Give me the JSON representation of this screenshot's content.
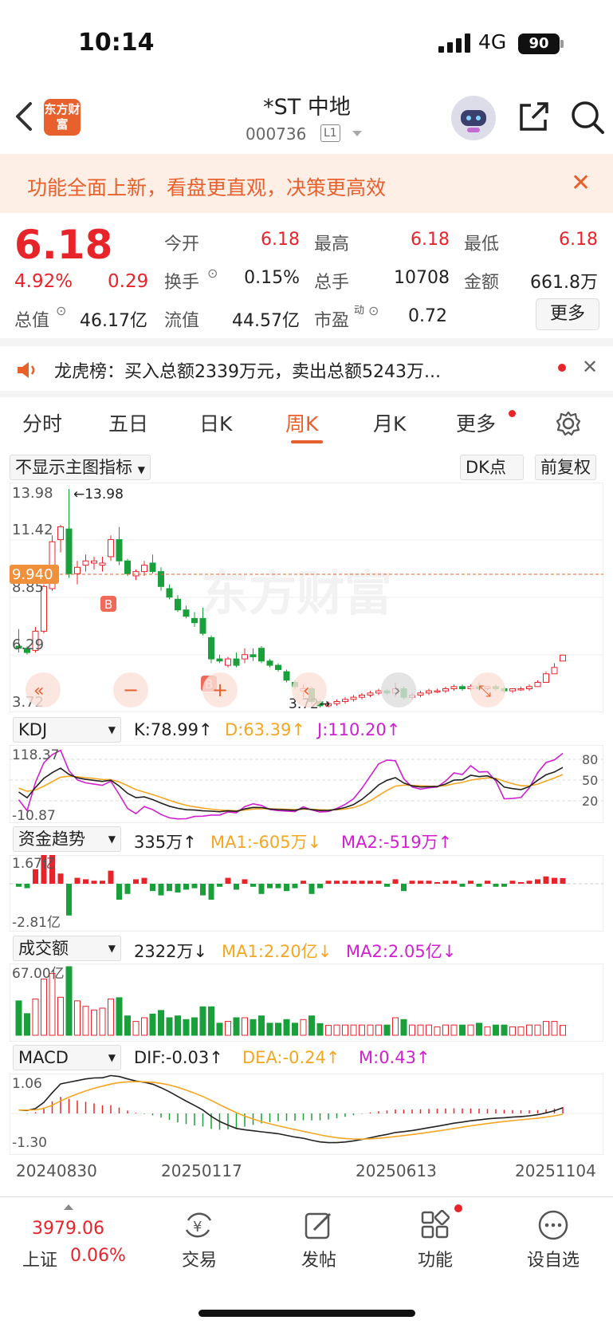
{
  "status_bar": {
    "time": "10:14",
    "network": "4G",
    "battery": "90"
  },
  "header": {
    "title": "*ST 中地",
    "code": "000736",
    "level": "L1",
    "logo_text": "东方财富"
  },
  "banner": {
    "text": "功能全面上新，看盘更直观，决策更高效"
  },
  "quote": {
    "price": "6.18",
    "change_pct": "4.92%",
    "change": "0.29",
    "open_label": "今开",
    "open": "6.18",
    "high_label": "最高",
    "high": "6.18",
    "low_label": "最低",
    "low": "6.18",
    "turnover_label": "换手",
    "turnover": "0.15%",
    "volume_label": "总手",
    "volume": "10708",
    "amount_label": "金额",
    "amount": "661.8万",
    "mktcap_label": "总值",
    "mktcap": "46.17亿",
    "float_label": "流值",
    "float": "44.57亿",
    "pe_label": "市盈",
    "pe_sup": "动",
    "pe": "0.72",
    "more_label": "更多"
  },
  "dragon_tiger": {
    "text": "龙虎榜：买入总额2339万元，卖出总额5243万..."
  },
  "tabs": [
    "分时",
    "五日",
    "日K",
    "周K",
    "月K",
    "更多"
  ],
  "active_tab": "周K",
  "chart_controls": {
    "indicator_select": "不显示主图指标",
    "dk_label": "DK点",
    "adjust_label": "前复权"
  },
  "colors": {
    "up": "#e8242b",
    "down": "#1aa03b",
    "accent": "#e8602c",
    "dif": "#222222",
    "dea": "#f5a623",
    "macd_m": "#d020d0"
  },
  "main_chart": {
    "y_labels": [
      "13.98",
      "11.42",
      "8.85",
      "6.29",
      "3.72"
    ],
    "current_price_tag": "9.940",
    "max_annotation": "←13.98",
    "min_annotation": "3.72→",
    "buy_marker": "B",
    "watermark": "东方财富"
  },
  "kdj": {
    "select": "KDJ",
    "k": "K:78.99",
    "d": "D:63.39",
    "j": "J:110.20",
    "y_top": "118.37",
    "y_bottom": "-10.87",
    "levels": [
      "80",
      "50",
      "20"
    ]
  },
  "fund_flow": {
    "select": "资金趋势",
    "value": "335万",
    "ma1": "MA1:-605万",
    "ma2": "MA2:-519万",
    "y_top": "1.67亿",
    "y_bottom": "-2.81亿"
  },
  "turnover_amount": {
    "select": "成交额",
    "value": "2322万",
    "ma1": "MA1:2.20亿",
    "ma2": "MA2:2.05亿",
    "y_top": "67.00亿"
  },
  "macd": {
    "select": "MACD",
    "dif": "DIF:-0.03",
    "dea": "DEA:-0.24",
    "m": "M:0.43",
    "y_top": "1.06",
    "y_bottom": "-1.30"
  },
  "x_dates": [
    "20240830",
    "20250117",
    "20250613",
    "20251104"
  ],
  "chart_data": {
    "type": "candlestick",
    "period": "weekly",
    "ylim": [
      3.72,
      13.98
    ],
    "candles": [
      [
        6.6,
        7.4,
        6.3,
        6.5
      ],
      [
        6.5,
        6.6,
        6.2,
        6.3
      ],
      [
        6.4,
        7.5,
        6.3,
        7.3
      ],
      [
        7.3,
        9.5,
        7.2,
        9.4
      ],
      [
        9.3,
        11.8,
        9.2,
        11.5
      ],
      [
        11.6,
        12.3,
        11.0,
        12.2
      ],
      [
        12.1,
        13.98,
        9.8,
        10.0
      ],
      [
        10.0,
        10.6,
        9.5,
        10.3
      ],
      [
        10.4,
        10.9,
        10.1,
        10.6
      ],
      [
        10.5,
        10.8,
        10.2,
        10.6
      ],
      [
        10.4,
        10.8,
        10.1,
        10.5
      ],
      [
        10.8,
        11.8,
        10.6,
        11.6
      ],
      [
        11.6,
        12.2,
        10.4,
        10.6
      ],
      [
        10.6,
        10.7,
        9.9,
        10.0
      ],
      [
        9.9,
        10.2,
        9.7,
        10.1
      ],
      [
        10.1,
        10.6,
        9.9,
        10.4
      ],
      [
        10.5,
        10.9,
        10.0,
        10.1
      ],
      [
        10.1,
        10.3,
        9.2,
        9.4
      ],
      [
        9.3,
        9.5,
        8.8,
        8.9
      ],
      [
        8.8,
        9.0,
        8.2,
        8.3
      ],
      [
        8.3,
        8.5,
        7.9,
        8.0
      ],
      [
        7.9,
        8.2,
        7.5,
        7.7
      ],
      [
        7.9,
        8.4,
        7.1,
        7.2
      ],
      [
        7.0,
        7.1,
        5.8,
        6.0
      ],
      [
        6.0,
        6.2,
        5.8,
        5.9
      ],
      [
        5.7,
        6.1,
        5.6,
        6.0
      ],
      [
        6.0,
        6.3,
        5.6,
        5.7
      ],
      [
        6.0,
        6.5,
        5.8,
        6.2
      ],
      [
        6.2,
        6.5,
        5.9,
        6.1
      ],
      [
        6.5,
        6.6,
        5.8,
        5.9
      ],
      [
        5.9,
        6.0,
        5.6,
        5.7
      ],
      [
        5.7,
        5.8,
        5.4,
        5.5
      ],
      [
        5.4,
        5.5,
        4.9,
        5.0
      ],
      [
        4.9,
        5.0,
        4.6,
        4.7
      ],
      [
        4.5,
        4.8,
        4.2,
        4.6
      ],
      [
        4.6,
        4.7,
        3.9,
        4.0
      ],
      [
        4.0,
        4.1,
        3.72,
        3.8
      ],
      [
        3.8,
        4.0,
        3.72,
        3.9
      ],
      [
        3.9,
        4.1,
        3.8,
        4.0
      ],
      [
        4.0,
        4.2,
        3.9,
        4.1
      ],
      [
        4.1,
        4.3,
        4.0,
        4.2
      ],
      [
        4.2,
        4.4,
        4.1,
        4.3
      ],
      [
        4.3,
        4.5,
        4.2,
        4.4
      ],
      [
        4.4,
        4.6,
        4.3,
        4.5
      ],
      [
        4.5,
        4.6,
        4.3,
        4.4
      ],
      [
        4.4,
        4.9,
        4.2,
        4.6
      ],
      [
        4.6,
        4.7,
        4.1,
        4.2
      ],
      [
        4.2,
        4.4,
        4.1,
        4.3
      ],
      [
        4.3,
        4.5,
        4.2,
        4.4
      ],
      [
        4.4,
        4.6,
        4.3,
        4.5
      ],
      [
        4.5,
        4.6,
        4.4,
        4.5
      ],
      [
        4.5,
        4.7,
        4.4,
        4.6
      ],
      [
        4.6,
        4.8,
        4.5,
        4.7
      ],
      [
        4.7,
        4.8,
        4.5,
        4.6
      ],
      [
        4.6,
        4.8,
        4.5,
        4.7
      ],
      [
        4.7,
        4.9,
        4.5,
        4.6
      ],
      [
        4.6,
        4.7,
        4.5,
        4.7
      ],
      [
        4.7,
        4.8,
        4.5,
        4.6
      ],
      [
        4.6,
        4.7,
        4.4,
        4.5
      ],
      [
        4.5,
        4.6,
        4.4,
        4.6
      ],
      [
        4.6,
        4.7,
        4.5,
        4.6
      ],
      [
        4.6,
        4.8,
        4.5,
        4.7
      ],
      [
        4.7,
        5.0,
        4.7,
        4.9
      ],
      [
        4.9,
        5.4,
        4.9,
        5.3
      ],
      [
        5.3,
        5.8,
        5.3,
        5.6
      ],
      [
        5.9,
        6.18,
        5.9,
        6.18
      ]
    ]
  },
  "bottom_bar": {
    "index_value": "3979.06",
    "index_name": "上证",
    "index_pct": "0.06%",
    "trade": "交易",
    "post": "发帖",
    "functions": "功能",
    "watchlist": "设自选"
  }
}
